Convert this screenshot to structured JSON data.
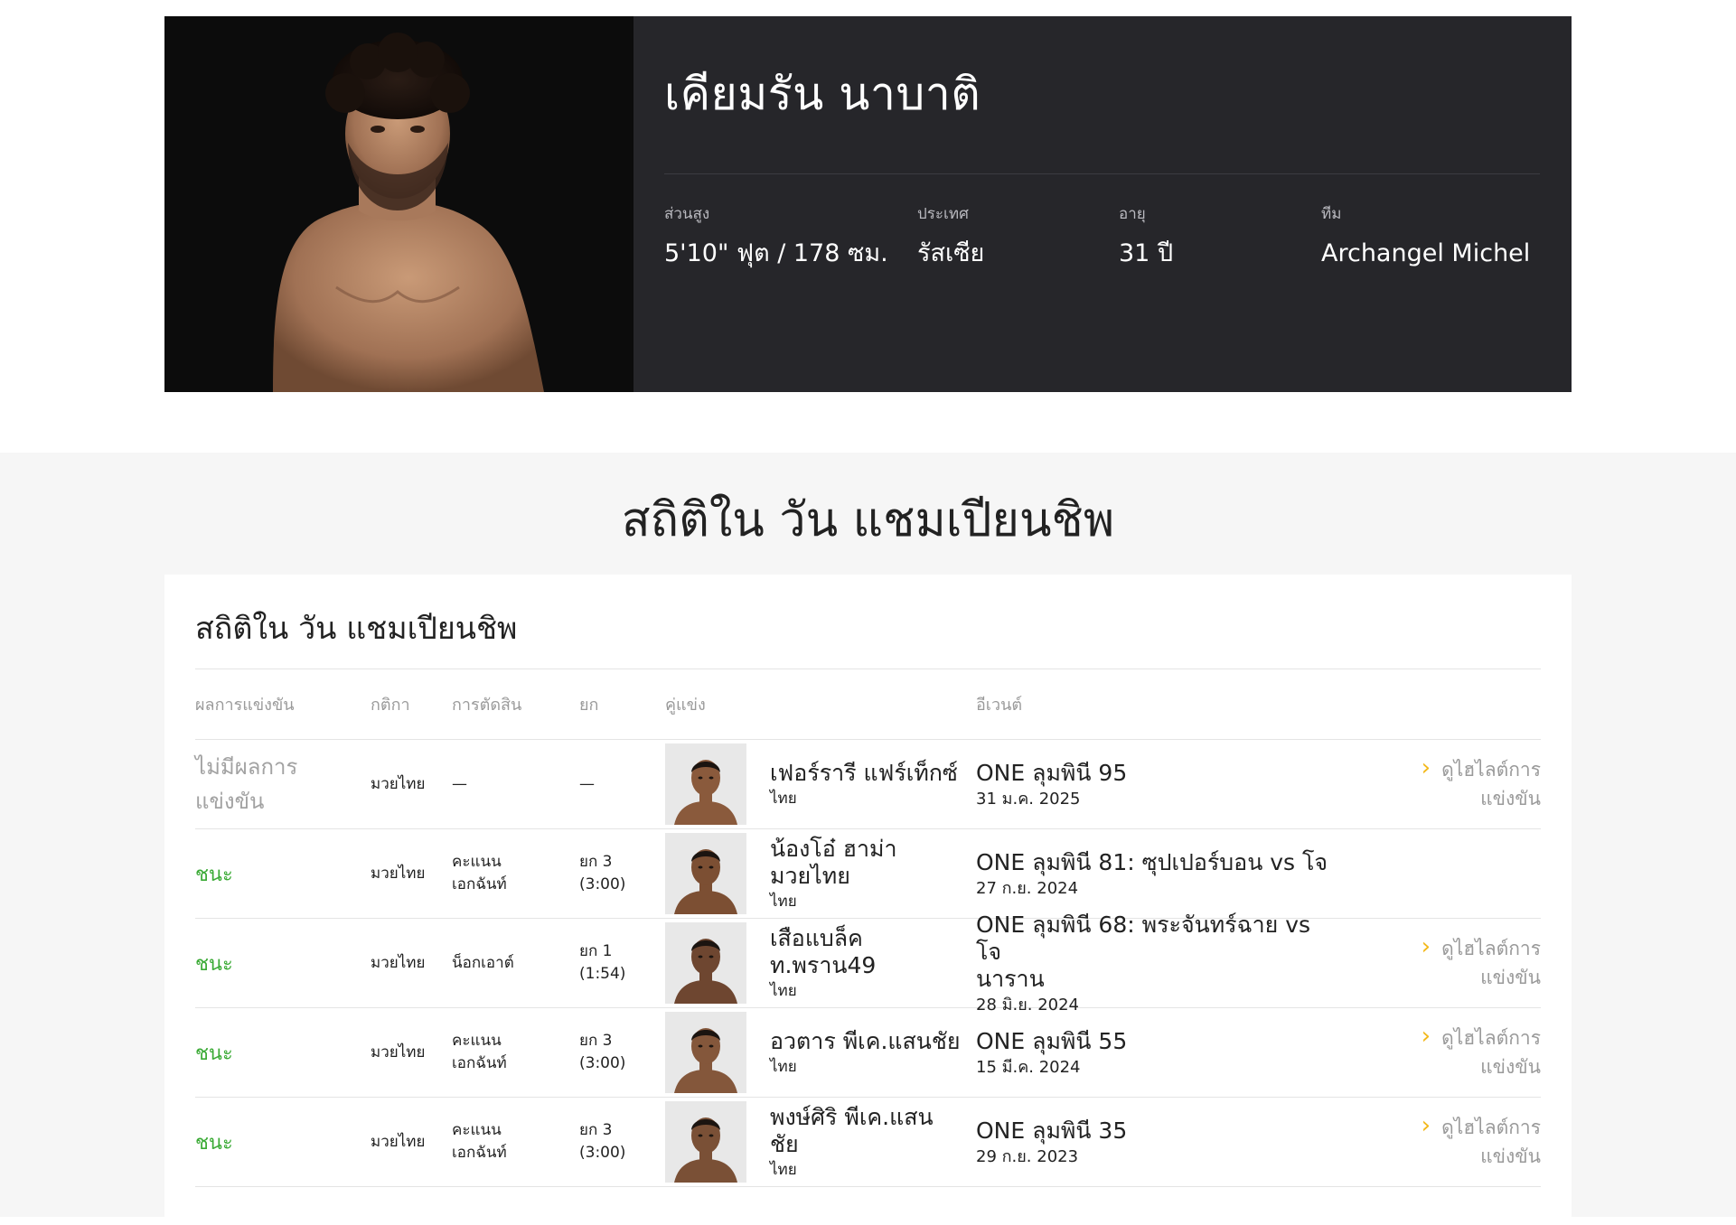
{
  "athlete": {
    "name": "เคียมรัน นาบาติ",
    "stats": [
      {
        "label": "ส่วนสูง",
        "value": "5'10\" ฟุต / 178 ซม."
      },
      {
        "label": "ประเทศ",
        "value": "รัสเซีย"
      },
      {
        "label": "อายุ",
        "value": "31 ปี"
      },
      {
        "label": "ทีม",
        "value": "Archangel Michel"
      }
    ]
  },
  "section": {
    "heading": "สถิติใน วัน แชมเปียนชิพ",
    "card_title": "สถิติใน วัน แชมเปียนชิพ"
  },
  "table": {
    "headers": {
      "result": "ผลการแข่งขัน",
      "rules": "กติกา",
      "method": "การตัดสิน",
      "round": "ยก",
      "opponent": "คู่แข่ง",
      "event": "อีเวนต์"
    },
    "rows": [
      {
        "result": "ไม่มีผลการแข่งขัน",
        "result_lines": [
          "ไม่มีผลการ",
          "แข่งขัน"
        ],
        "result_type": "none",
        "rules": "มวยไทย",
        "method_lines": [
          "—"
        ],
        "round_lines": [
          "—"
        ],
        "opponent_lines": [
          "เฟอร์รารี แฟร์เท็กซ์"
        ],
        "opponent_country": "ไทย",
        "event_lines": [
          "ONE ลุมพินี 95"
        ],
        "event_date": "31 ม.ค. 2025",
        "highlight_lines": [
          "ดูไฮไลต์การ",
          "แข่งขัน"
        ]
      },
      {
        "result_lines": [
          "ชนะ"
        ],
        "result_type": "win",
        "rules": "มวยไทย",
        "method_lines": [
          "คะแนน",
          "เอกฉันท์"
        ],
        "round_lines": [
          "ยก 3",
          "(3:00)"
        ],
        "opponent_lines": [
          "น้องโอ๋ ฮาม่า",
          "มวยไทย"
        ],
        "opponent_country": "ไทย",
        "event_lines": [
          "ONE ลุมพินี 81: ซุปเปอร์บอน vs โจ"
        ],
        "event_date": "27 ก.ย. 2024",
        "highlight_lines": []
      },
      {
        "result_lines": [
          "ชนะ"
        ],
        "result_type": "win",
        "rules": "มวยไทย",
        "method_lines": [
          "น็อกเอาต์"
        ],
        "round_lines": [
          "ยก 1",
          "(1:54)"
        ],
        "opponent_lines": [
          "เสือแบล็ค",
          "ท.พราน49"
        ],
        "opponent_country": "ไทย",
        "event_lines": [
          "ONE ลุมพินี 68: พระจันทร์ฉาย vs โจ",
          "นาราน"
        ],
        "event_date": "28 มิ.ย. 2024",
        "highlight_lines": [
          "ดูไฮไลต์การ",
          "แข่งขัน"
        ]
      },
      {
        "result_lines": [
          "ชนะ"
        ],
        "result_type": "win",
        "rules": "มวยไทย",
        "method_lines": [
          "คะแนน",
          "เอกฉันท์"
        ],
        "round_lines": [
          "ยก 3",
          "(3:00)"
        ],
        "opponent_lines": [
          "อวตาร พีเค.แสนชัย"
        ],
        "opponent_country": "ไทย",
        "event_lines": [
          "ONE ลุมพินี 55"
        ],
        "event_date": "15 มี.ค. 2024",
        "highlight_lines": [
          "ดูไฮไลต์การ",
          "แข่งขัน"
        ]
      },
      {
        "result_lines": [
          "ชนะ"
        ],
        "result_type": "win",
        "rules": "มวยไทย",
        "method_lines": [
          "คะแนน",
          "เอกฉันท์"
        ],
        "round_lines": [
          "ยก 3",
          "(3:00)"
        ],
        "opponent_lines": [
          "พงษ์ศิริ พีเค.แสน",
          "ชัย"
        ],
        "opponent_country": "ไทย",
        "event_lines": [
          "ONE ลุมพินี 35"
        ],
        "event_date": "29 ก.ย. 2023",
        "highlight_lines": [
          "ดูไฮไลต์การ",
          "แข่งขัน"
        ]
      }
    ]
  },
  "colors": {
    "hero_bg": "#26262a",
    "photo_bg": "#0c0c0c",
    "win": "#3aaa35",
    "chevron": "#f3b81a",
    "section_bg": "#f6f6f6"
  },
  "icons": {
    "highlight_chevron": "chevron-right-icon"
  }
}
